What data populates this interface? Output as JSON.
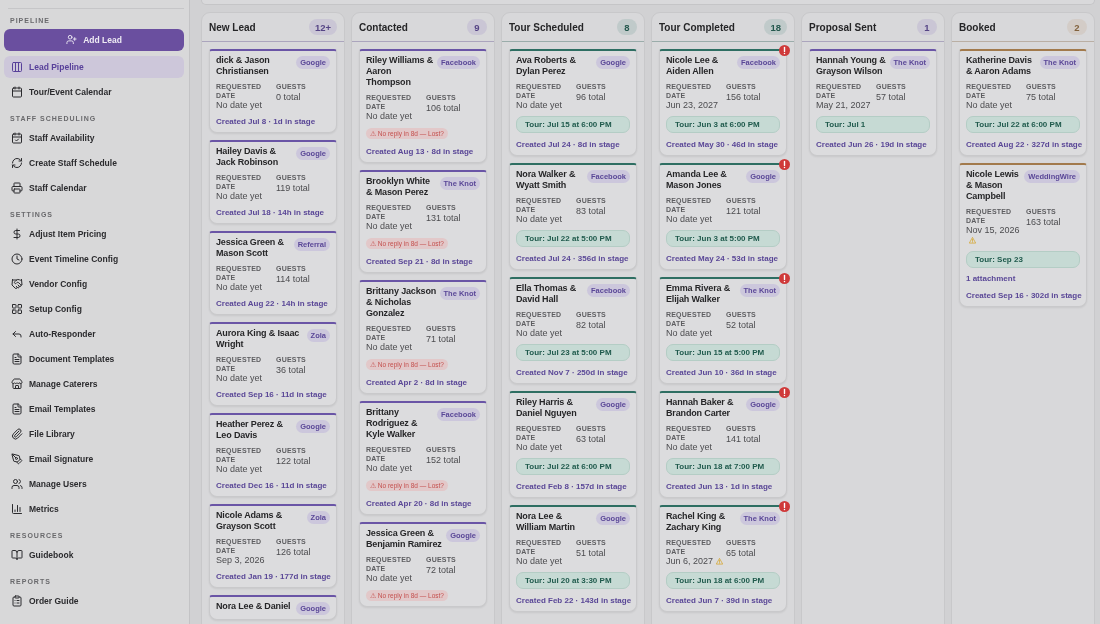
{
  "sidebar": {
    "sections": [
      {
        "label": "PIPELINE",
        "action": "Add Lead",
        "items": [
          {
            "label": "Lead Pipeline",
            "selected": true
          },
          {
            "label": "Tour/Event Calendar",
            "selected": false
          }
        ]
      },
      {
        "label": "STAFF SCHEDULING",
        "items": [
          {
            "label": "Staff Availability",
            "selected": false
          },
          {
            "label": "Create Staff Schedule",
            "selected": false
          },
          {
            "label": "Staff Calendar",
            "selected": false
          }
        ]
      },
      {
        "label": "SETTINGS",
        "items": [
          {
            "label": "Adjust Item Pricing",
            "selected": false
          },
          {
            "label": "Event Timeline Config",
            "selected": false
          },
          {
            "label": "Vendor Config",
            "selected": false
          },
          {
            "label": "Setup Config",
            "selected": false
          },
          {
            "label": "Auto-Responder",
            "selected": false
          },
          {
            "label": "Document Templates",
            "selected": false
          },
          {
            "label": "Manage Caterers",
            "selected": false
          },
          {
            "label": "Email Templates",
            "selected": false
          },
          {
            "label": "File Library",
            "selected": false
          },
          {
            "label": "Email Signature",
            "selected": false
          },
          {
            "label": "Manage Users",
            "selected": false
          },
          {
            "label": "Metrics",
            "selected": false
          }
        ]
      },
      {
        "label": "RESOURCES",
        "items": [
          {
            "label": "Guidebook",
            "selected": false
          }
        ]
      },
      {
        "label": "REPORTS",
        "items": [
          {
            "label": "Order Guide",
            "selected": false
          }
        ]
      }
    ]
  },
  "board": {
    "columns": [
      {
        "title": "New Lead",
        "count": "12+",
        "color": "#6a55a6",
        "cards": [
          {
            "name": "dick & Jason Christiansen",
            "source": "Google",
            "date_label": "REQUESTED DATE",
            "date": "No date yet",
            "date_flag": false,
            "guests_label": "GUESTS",
            "guests": "0 total",
            "created": "Created Jul 8 · 1d in stage",
            "flagged": false
          },
          {
            "name": "Hailey Davis & Jack Robinson",
            "source": "Google",
            "date_label": "REQUESTED DATE",
            "date": "No date yet",
            "date_flag": false,
            "guests_label": "GUESTS",
            "guests": "119 total",
            "created": "Created Jul 18 · 14h in stage",
            "flagged": false
          },
          {
            "name": "Jessica Green & Mason Scott",
            "source": "Referral",
            "date_label": "REQUESTED DATE",
            "date": "No date yet",
            "date_flag": false,
            "guests_label": "GUESTS",
            "guests": "114 total",
            "created": "Created Aug 22 · 14h in stage",
            "flagged": false
          },
          {
            "name": "Aurora King & Isaac Wright",
            "source": "Zola",
            "date_label": "REQUESTED DATE",
            "date": "No date yet",
            "date_flag": false,
            "guests_label": "GUESTS",
            "guests": "36 total",
            "created": "Created Sep 16 · 11d in stage",
            "flagged": false
          },
          {
            "name": "Heather Perez & Leo Davis",
            "source": "Google",
            "date_label": "REQUESTED DATE",
            "date": "No date yet",
            "date_flag": false,
            "guests_label": "GUESTS",
            "guests": "122 total",
            "created": "Created Dec 16 · 11d in stage",
            "flagged": false
          },
          {
            "name": "Nicole Adams & Grayson Scott",
            "source": "Zola",
            "date_label": "REQUESTED DATE",
            "date": "Sep 3, 2026",
            "date_flag": false,
            "guests_label": "GUESTS",
            "guests": "126 total",
            "created": "Created Jan 19 · 177d in stage",
            "flagged": false
          },
          {
            "name": "Nora Lee & Daniel",
            "source": "Google",
            "flagged": false
          }
        ]
      },
      {
        "title": "Contacted",
        "count": "9",
        "color": "#6a55a6",
        "cards": [
          {
            "name": "Riley Williams & Aaron Thompson",
            "source": "Facebook",
            "date_label": "REQUESTED DATE",
            "date": "No date yet",
            "date_flag": false,
            "guests_label": "GUESTS",
            "guests": "106 total",
            "warning": "⚠ No reply in 8d — Lost?",
            "created": "Created Aug 13 · 8d in stage",
            "flagged": false
          },
          {
            "name": "Brooklyn White & Mason Perez",
            "source": "The Knot",
            "date_label": "REQUESTED DATE",
            "date": "No date yet",
            "date_flag": false,
            "guests_label": "GUESTS",
            "guests": "131 total",
            "warning": "⚠ No reply in 8d — Lost?",
            "created": "Created Sep 21 · 8d in stage",
            "flagged": false
          },
          {
            "name": "Brittany Jackson & Nicholas Gonzalez",
            "source": "The Knot",
            "date_label": "REQUESTED DATE",
            "date": "No date yet",
            "date_flag": false,
            "guests_label": "GUESTS",
            "guests": "71 total",
            "warning": "⚠ No reply in 8d — Lost?",
            "created": "Created Apr 2 · 8d in stage",
            "flagged": false
          },
          {
            "name": "Brittany Rodriguez & Kyle Walker",
            "source": "Facebook",
            "date_label": "REQUESTED DATE",
            "date": "No date yet",
            "date_flag": false,
            "guests_label": "GUESTS",
            "guests": "152 total",
            "warning": "⚠ No reply in 8d — Lost?",
            "created": "Created Apr 20 · 8d in stage",
            "flagged": false
          },
          {
            "name": "Jessica Green & Benjamin Ramirez",
            "source": "Google",
            "date_label": "REQUESTED DATE",
            "date": "No date yet",
            "date_flag": false,
            "guests_label": "GUESTS",
            "guests": "72 total",
            "warning": "⚠ No reply in 8d — Lost?",
            "flagged": false
          }
        ]
      },
      {
        "title": "Tour Scheduled",
        "count": "8",
        "color": "#2e6e62",
        "cards": [
          {
            "name": "Ava Roberts & Dylan Perez",
            "source": "Google",
            "date_label": "REQUESTED DATE",
            "date": "No date yet",
            "date_flag": false,
            "guests_label": "GUESTS",
            "guests": "96 total",
            "tour": "Tour: Jul 15 at 6:00 PM",
            "created": "Created Jul 24 · 8d in stage",
            "flagged": false
          },
          {
            "name": "Nora Walker & Wyatt Smith",
            "source": "Facebook",
            "date_label": "REQUESTED DATE",
            "date": "No date yet",
            "date_flag": false,
            "guests_label": "GUESTS",
            "guests": "83 total",
            "tour": "Tour: Jul 22 at 5:00 PM",
            "created": "Created Jul 24 · 356d in stage",
            "flagged": false
          },
          {
            "name": "Ella Thomas & David Hall",
            "source": "Facebook",
            "date_label": "REQUESTED DATE",
            "date": "No date yet",
            "date_flag": false,
            "guests_label": "GUESTS",
            "guests": "82 total",
            "tour": "Tour: Jul 23 at 5:00 PM",
            "created": "Created Nov 7 · 250d in stage",
            "flagged": false
          },
          {
            "name": "Riley Harris & Daniel Nguyen",
            "source": "Google",
            "date_label": "REQUESTED DATE",
            "date": "No date yet",
            "date_flag": false,
            "guests_label": "GUESTS",
            "guests": "63 total",
            "tour": "Tour: Jul 22 at 6:00 PM",
            "created": "Created Feb 8 · 157d in stage",
            "flagged": false
          },
          {
            "name": "Nora Lee & William Martin",
            "source": "Google",
            "date_label": "REQUESTED DATE",
            "date": "No date yet",
            "date_flag": false,
            "guests_label": "GUESTS",
            "guests": "51 total",
            "tour": "Tour: Jul 20 at 3:30 PM",
            "created": "Created Feb 22 · 143d in stage",
            "flagged": false
          }
        ]
      },
      {
        "title": "Tour Completed",
        "count": "18",
        "color": "#2e6e62",
        "cards": [
          {
            "name": "Nicole Lee & Aiden Allen",
            "source": "Facebook",
            "date_label": "REQUESTED DATE",
            "date": "Jun 23, 2027",
            "date_flag": false,
            "guests_label": "GUESTS",
            "guests": "156 total",
            "tour": "Tour: Jun 3 at 6:00 PM",
            "created": "Created May 30 · 46d in stage",
            "flagged": true
          },
          {
            "name": "Amanda Lee & Mason Jones",
            "source": "Google",
            "date_label": "REQUESTED DATE",
            "date": "No date yet",
            "date_flag": false,
            "guests_label": "GUESTS",
            "guests": "121 total",
            "tour": "Tour: Jun 3 at 5:00 PM",
            "created": "Created May 24 · 53d in stage",
            "flagged": true
          },
          {
            "name": "Emma Rivera & Elijah Walker",
            "source": "The Knot",
            "date_label": "REQUESTED DATE",
            "date": "No date yet",
            "date_flag": false,
            "guests_label": "GUESTS",
            "guests": "52 total",
            "tour": "Tour: Jun 15 at 5:00 PM",
            "created": "Created Jun 10 · 36d in stage",
            "flagged": true
          },
          {
            "name": "Hannah Baker & Brandon Carter",
            "source": "Google",
            "date_label": "REQUESTED DATE",
            "date": "No date yet",
            "date_flag": false,
            "guests_label": "GUESTS",
            "guests": "141 total",
            "tour": "Tour: Jun 18 at 7:00 PM",
            "created": "Created Jun 13 · 1d in stage",
            "flagged": true
          },
          {
            "name": "Rachel King & Zachary King",
            "source": "The Knot",
            "date_label": "REQUESTED DATE",
            "date": "Jun 6, 2027",
            "date_flag": true,
            "guests_label": "GUESTS",
            "guests": "65 total",
            "tour": "Tour: Jun 18 at 6:00 PM",
            "created": "Created Jun 7 · 39d in stage",
            "flagged": true
          }
        ]
      },
      {
        "title": "Proposal Sent",
        "count": "1",
        "color": "#6a55a6",
        "cards": [
          {
            "name": "Hannah Young & Grayson Wilson",
            "source": "The Knot",
            "date_label": "REQUESTED DATE",
            "date": "May 21, 2027",
            "date_flag": false,
            "guests_label": "GUESTS",
            "guests": "57 total",
            "tour": "Tour: Jul 1",
            "created": "Created Jun 26 · 19d in stage",
            "flagged": false
          }
        ]
      },
      {
        "title": "Booked",
        "count": "2",
        "color": "#a27a4c",
        "cards": [
          {
            "name": "Katherine Davis & Aaron Adams",
            "source": "The Knot",
            "date_label": "REQUESTED DATE",
            "date": "No date yet",
            "date_flag": false,
            "guests_label": "GUESTS",
            "guests": "75 total",
            "tour": "Tour: Jul 22 at 6:00 PM",
            "created": "Created Aug 22 · 327d in stage",
            "flagged": false
          },
          {
            "name": "Nicole Lewis & Mason Campbell",
            "source": "WeddingWire",
            "date_label": "REQUESTED DATE",
            "date": "Nov 15, 2026",
            "date_flag": true,
            "guests_label": "GUESTS",
            "guests": "163 total",
            "tour": "Tour: Sep 23",
            "attachment": "1 attachment",
            "created": "Created Sep 16 · 302d in stage",
            "flagged": false
          }
        ]
      }
    ]
  }
}
